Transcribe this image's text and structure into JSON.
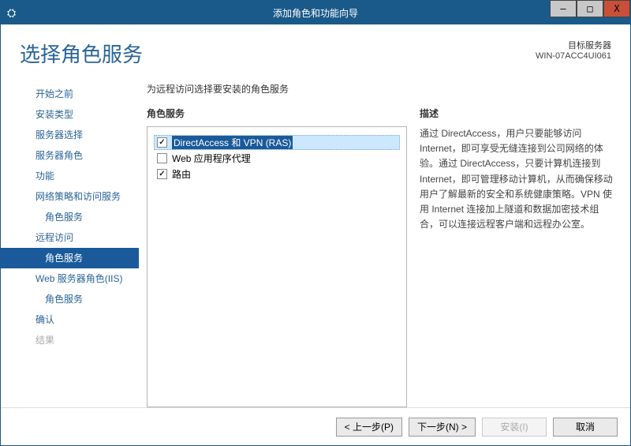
{
  "window": {
    "title": "添加角色和功能向导",
    "minimize": "—",
    "maximize": "□",
    "close": "X"
  },
  "header": {
    "page_title": "选择角色服务",
    "target_label": "目标服务器",
    "target_value": "WIN-07ACC4UI061"
  },
  "nav": {
    "items": [
      {
        "label": "开始之前",
        "sub": false,
        "active": false,
        "disabled": false
      },
      {
        "label": "安装类型",
        "sub": false,
        "active": false,
        "disabled": false
      },
      {
        "label": "服务器选择",
        "sub": false,
        "active": false,
        "disabled": false
      },
      {
        "label": "服务器角色",
        "sub": false,
        "active": false,
        "disabled": false
      },
      {
        "label": "功能",
        "sub": false,
        "active": false,
        "disabled": false
      },
      {
        "label": "网络策略和访问服务",
        "sub": false,
        "active": false,
        "disabled": false
      },
      {
        "label": "角色服务",
        "sub": true,
        "active": false,
        "disabled": false
      },
      {
        "label": "远程访问",
        "sub": false,
        "active": false,
        "disabled": false
      },
      {
        "label": "角色服务",
        "sub": true,
        "active": true,
        "disabled": false
      },
      {
        "label": "Web 服务器角色(IIS)",
        "sub": false,
        "active": false,
        "disabled": false
      },
      {
        "label": "角色服务",
        "sub": true,
        "active": false,
        "disabled": false
      },
      {
        "label": "确认",
        "sub": false,
        "active": false,
        "disabled": false
      },
      {
        "label": "结果",
        "sub": false,
        "active": false,
        "disabled": true
      }
    ]
  },
  "content": {
    "subtitle": "为远程访问选择要安装的角色服务",
    "roles_header": "角色服务",
    "desc_header": "描述",
    "roles": [
      {
        "label": "DirectAccess 和 VPN (RAS)",
        "checked": true,
        "selected": true
      },
      {
        "label": "Web 应用程序代理",
        "checked": false,
        "selected": false
      },
      {
        "label": "路由",
        "checked": true,
        "selected": false
      }
    ],
    "description": "通过 DirectAccess，用户只要能够访问 Internet，即可享受无缝连接到公司网络的体验。通过 DirectAccess，只要计算机连接到 Internet，即可管理移动计算机，从而确保移动用户了解最新的安全和系统健康策略。VPN 使用 Internet 连接加上隧道和数据加密技术组合，可以连接远程客户端和远程办公室。"
  },
  "footer": {
    "prev": "< 上一步(P)",
    "next": "下一步(N) >",
    "install": "安装(I)",
    "cancel": "取消"
  },
  "watermark": ""
}
